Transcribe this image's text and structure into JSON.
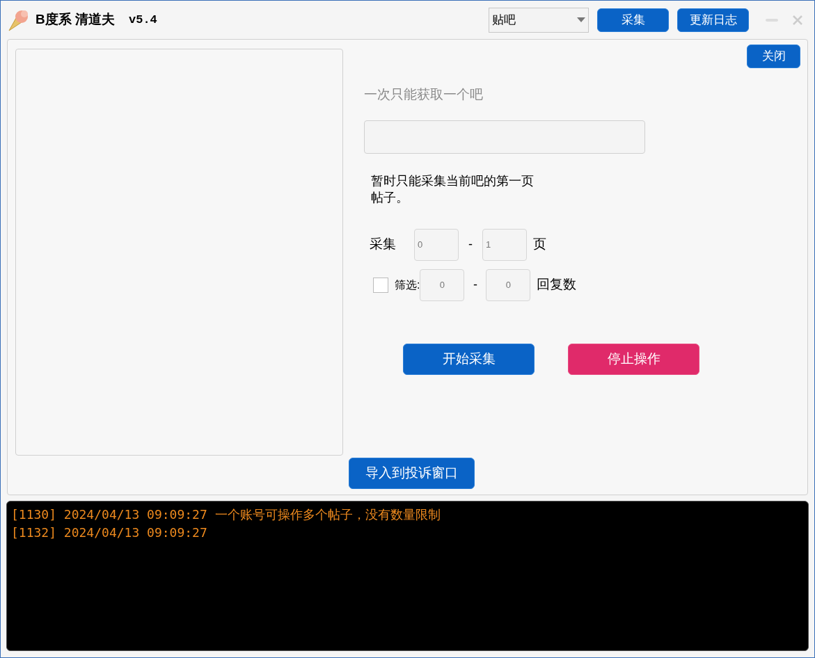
{
  "window": {
    "title": "B度系 清道夫",
    "version": "v5.4"
  },
  "toolbar": {
    "dropdown": {
      "value": "贴吧"
    },
    "buttons": [
      "采集",
      "更新日志"
    ]
  },
  "panel": {
    "close_button": "关闭",
    "hint": "一次只能获取一个吧",
    "note": "暂时只能采集当前吧的第一页帖子。",
    "page_range": {
      "label": "采集",
      "from": "0",
      "separator": "-",
      "to": "1",
      "unit": "页"
    },
    "filter": {
      "checked": false,
      "label": "筛选:",
      "from": "0",
      "separator": "-",
      "to": "0",
      "unit": "回复数"
    },
    "actions": [
      {
        "label": "开始采集",
        "kind": "primary"
      },
      {
        "label": "停止操作",
        "kind": "danger"
      }
    ],
    "import_button": "导入到投诉窗口"
  },
  "log": [
    {
      "text": "[1130] 2024/04/13 09:09:27 一个账号可操作多个帖子，没有数量限制"
    },
    {
      "text": "[1132] 2024/04/13 09:09:27"
    }
  ]
}
